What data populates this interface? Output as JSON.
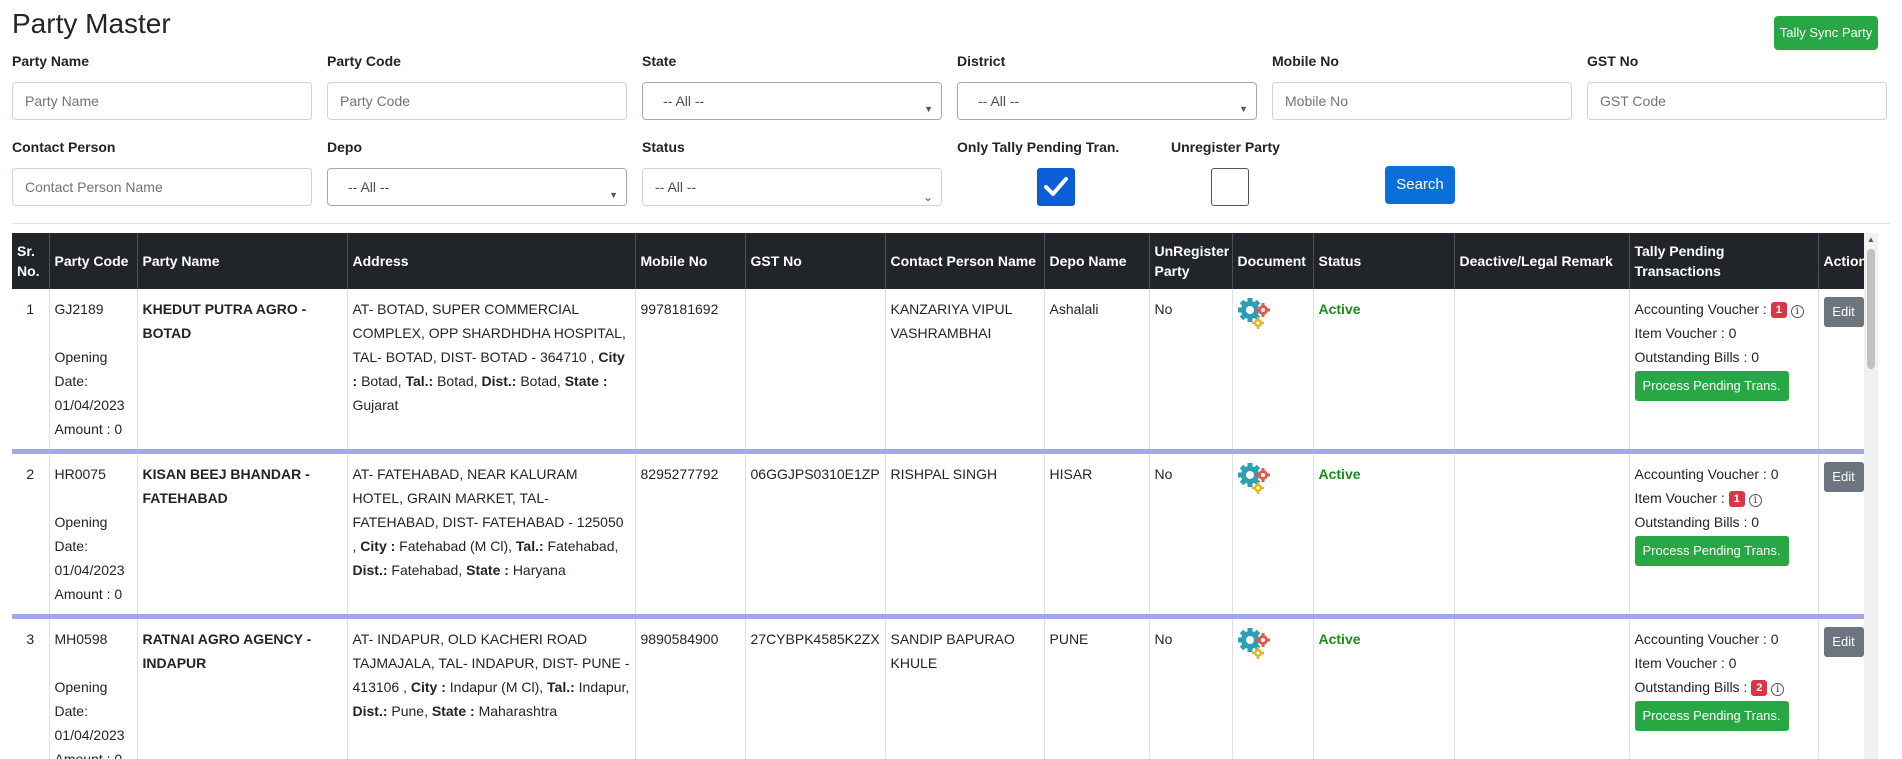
{
  "page": {
    "title": "Party Master",
    "tally_sync_label": "Tally Sync Party"
  },
  "filters": {
    "party_name": {
      "label": "Party Name",
      "placeholder": "Party Name"
    },
    "party_code": {
      "label": "Party Code",
      "placeholder": "Party Code"
    },
    "state": {
      "label": "State",
      "value": "-- All --"
    },
    "district": {
      "label": "District",
      "value": "-- All --"
    },
    "mobile_no": {
      "label": "Mobile No",
      "placeholder": "Mobile No"
    },
    "gst_no": {
      "label": "GST No",
      "placeholder": "GST Code"
    },
    "contact_person": {
      "label": "Contact Person",
      "placeholder": "Contact Person Name"
    },
    "depo": {
      "label": "Depo",
      "value": "-- All --"
    },
    "status": {
      "label": "Status",
      "value": "-- All --"
    },
    "only_tally_pending": {
      "label": "Only Tally Pending Tran.",
      "checked": true
    },
    "unregister_party": {
      "label": "Unregister Party",
      "checked": false
    },
    "search_label": "Search"
  },
  "table": {
    "headers": {
      "sr_no": "Sr. No.",
      "party_code": "Party Code",
      "party_name": "Party Name",
      "address": "Address",
      "mobile_no": "Mobile No",
      "gst_no": "GST No",
      "contact_person": "Contact Person Name",
      "depo_name": "Depo Name",
      "unregister": "UnRegister Party",
      "document": "Document",
      "status": "Status",
      "remark": "Deactive/Legal Remark",
      "tally_pending": "Tally Pending Transactions",
      "action": "Action"
    },
    "labels": {
      "opening_date": "Opening Date:",
      "amount": "Amount : 0",
      "city": "City :",
      "tal": "Tal.:",
      "dist": "Dist.:",
      "state": "State :",
      "accounting_voucher": "Accounting Voucher :",
      "item_voucher": "Item Voucher :",
      "outstanding_bills": "Outstanding Bills :",
      "process_btn": "Process Pending Trans.",
      "edit_btn": "Edit",
      "info_glyph": "i"
    },
    "rows": [
      {
        "sr": "1",
        "code": "GJ2189",
        "opening_date": "01/04/2023",
        "name": "KHEDUT PUTRA AGRO - BOTAD",
        "address": "AT- BOTAD, SUPER COMMERCIAL COMPLEX, OPP SHARDHDHA HOSPITAL, TAL- BOTAD, DIST- BOTAD - 364710 ,",
        "city": "Botad,",
        "tal": "Botad,",
        "dist": "Botad,",
        "state": "Gujarat",
        "mobile": "9978181692",
        "gst": "",
        "contact": "KANZARIYA VIPUL VASHRAMBHAI",
        "depo": "Ashalali",
        "unregister": "No",
        "status": "Active",
        "remark": "",
        "acc_voucher": "1",
        "item_voucher": "0",
        "outstanding": "0"
      },
      {
        "sr": "2",
        "code": "HR0075",
        "opening_date": "01/04/2023",
        "name": "KISAN BEEJ BHANDAR - FATEHABAD",
        "address": "AT- FATEHABAD, NEAR KALURAM HOTEL, GRAIN MARKET, TAL- FATEHABAD, DIST- FATEHABAD - 125050 ,",
        "city": "Fatehabad (M Cl),",
        "tal": "Fatehabad,",
        "dist": "Fatehabad,",
        "state": "Haryana",
        "mobile": "8295277792",
        "gst": "06GGJPS0310E1ZP",
        "contact": "RISHPAL SINGH",
        "depo": "HISAR",
        "unregister": "No",
        "status": "Active",
        "remark": "",
        "acc_voucher": "0",
        "item_voucher": "1",
        "outstanding": "0"
      },
      {
        "sr": "3",
        "code": "MH0598",
        "opening_date": "01/04/2023",
        "name": "RATNAI AGRO AGENCY - INDAPUR",
        "address": "AT- INDAPUR, OLD KACHERI ROAD TAJMAJALA, TAL- INDAPUR, DIST- PUNE - 413106 ,",
        "city": "Indapur (M Cl),",
        "tal": "Indapur,",
        "dist": "Pune,",
        "state": "Maharashtra",
        "mobile": "9890584900",
        "gst": "27CYBPK4585K2ZX",
        "contact": "SANDIP BAPURAO KHULE",
        "depo": "PUNE",
        "unregister": "No",
        "status": "Active",
        "remark": "",
        "acc_voucher": "0",
        "item_voucher": "0",
        "outstanding": "2"
      }
    ]
  },
  "colors": {
    "accent_blue": "#0b6fd9",
    "success_green": "#28a745",
    "header_dark": "#212529",
    "row_divider": "#a3a7e6",
    "badge_red": "#dc3545"
  }
}
